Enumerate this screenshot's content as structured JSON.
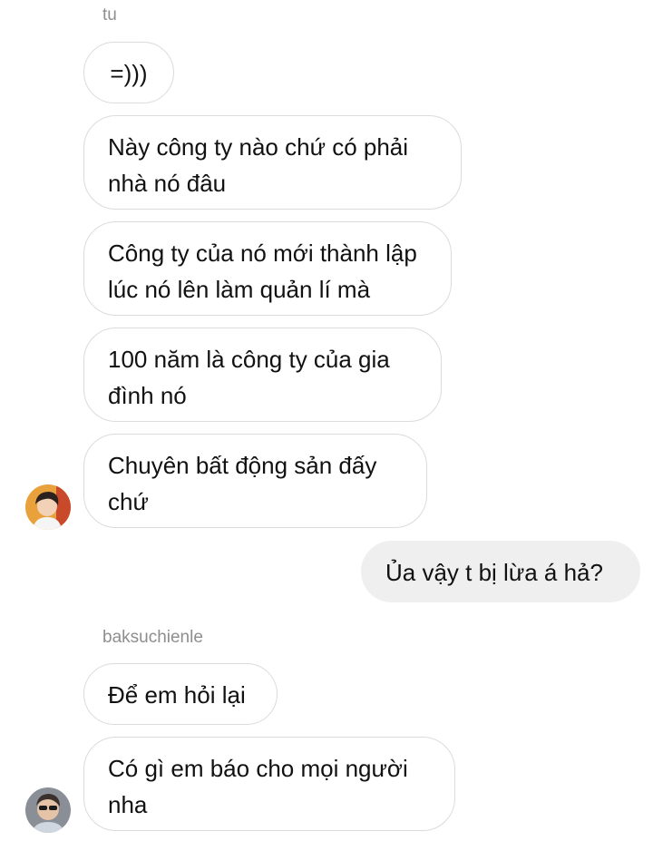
{
  "thread": {
    "sender_1": "tu",
    "sender_2": "baksuchienle",
    "messages_1": [
      "=)))",
      "Này công ty nào chứ có phải nhà nó đâu",
      "Công ty của nó mới thành lập lúc nó lên làm quản lí mà",
      "100 năm là công ty của gia đình nó",
      "Chuyên bất động sản đấy chứ"
    ],
    "my_message": "Ủa vậy t bị lừa á hả?",
    "messages_2": [
      "Để em hỏi lại",
      "Có gì em báo cho mọi người nha"
    ]
  },
  "colors": {
    "incoming_bubble_border": "#dbdbdb",
    "outgoing_bubble_bg": "#efefef",
    "sender_label": "#8e8e8e"
  },
  "icons": {
    "avatar_1": "user-avatar-photo",
    "avatar_2": "user-avatar-photo"
  }
}
